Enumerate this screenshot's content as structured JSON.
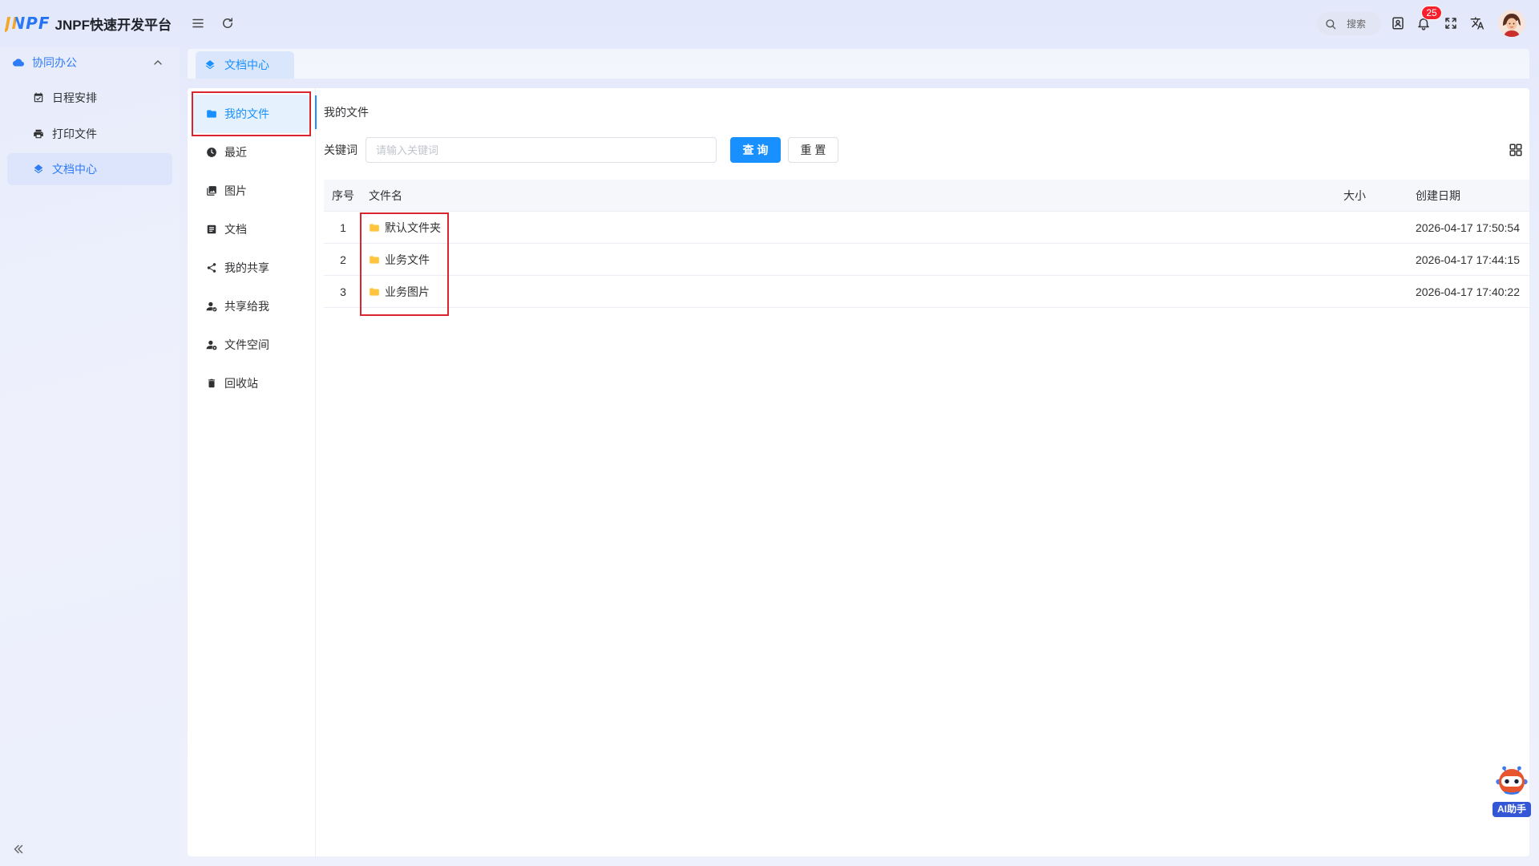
{
  "app": {
    "logo_mark": "JNPF",
    "title": "JNPF快速开发平台"
  },
  "header": {
    "search_placeholder": "搜索",
    "notification_count": "25",
    "icons": [
      "menu-toggle-icon",
      "refresh-icon",
      "search-icon",
      "contact-card-icon",
      "bell-icon",
      "fullscreen-icon",
      "translate-icon",
      "avatar"
    ]
  },
  "sidebar": {
    "group": {
      "label": "协同办公",
      "icon": "cloud-icon",
      "expanded": true
    },
    "items": [
      {
        "label": "日程安排",
        "icon": "calendar-icon",
        "active": false
      },
      {
        "label": "打印文件",
        "icon": "printer-icon",
        "active": false
      },
      {
        "label": "文档中心",
        "icon": "layers-icon",
        "active": true
      }
    ],
    "collapse_icon": "double-chevron-left-icon"
  },
  "tabs": [
    {
      "label": "文档中心",
      "icon": "layers-icon",
      "active": true
    }
  ],
  "file_nav": {
    "items": [
      {
        "label": "我的文件",
        "icon": "folder-icon",
        "active": true
      },
      {
        "label": "最近",
        "icon": "clock-icon",
        "active": false
      },
      {
        "label": "图片",
        "icon": "image-icon",
        "active": false
      },
      {
        "label": "文档",
        "icon": "document-icon",
        "active": false
      },
      {
        "label": "我的共享",
        "icon": "share-icon",
        "active": false
      },
      {
        "label": "共享给我",
        "icon": "user-share-icon",
        "active": false
      },
      {
        "label": "文件空间",
        "icon": "user-space-icon",
        "active": false
      },
      {
        "label": "回收站",
        "icon": "trash-icon",
        "active": false
      }
    ]
  },
  "content": {
    "breadcrumb": "我的文件",
    "search": {
      "label": "关键词",
      "placeholder": "请输入关键词",
      "value": "",
      "query_button": "查 询",
      "reset_button": "重 置"
    },
    "view_toggle_icon": "grid-view-icon",
    "table": {
      "columns": {
        "index": "序号",
        "name": "文件名",
        "size": "大小",
        "created": "创建日期"
      },
      "rows": [
        {
          "index": "1",
          "name": "默认文件夹",
          "icon": "folder-icon",
          "size": "",
          "created": "2026-04-17 17:50:54"
        },
        {
          "index": "2",
          "name": "业务文件",
          "icon": "folder-icon",
          "size": "",
          "created": "2026-04-17 17:44:15"
        },
        {
          "index": "3",
          "name": "业务图片",
          "icon": "folder-icon",
          "size": "",
          "created": "2026-04-17 17:40:22"
        }
      ]
    }
  },
  "ai_assistant": {
    "label": "AI助手",
    "icon": "robot-icon"
  },
  "colors": {
    "primary": "#1890ff",
    "highlight_box": "#d9252d",
    "folder": "#ffc53d",
    "badge": "#f5222d",
    "ai_badge": "#3457d5"
  }
}
